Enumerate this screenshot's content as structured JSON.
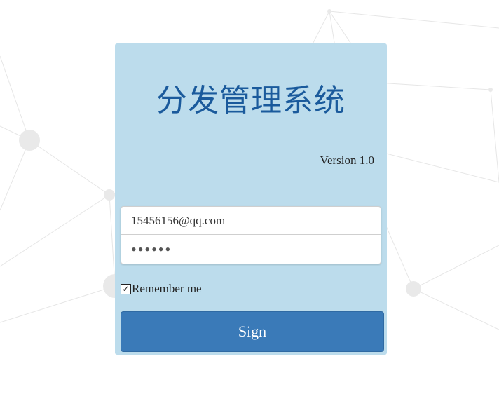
{
  "app": {
    "title": "分发管理系统",
    "version": "Version 1.0"
  },
  "form": {
    "email_value": "15456156@qq.com",
    "password_value": "••••••",
    "remember_label": "Remember me",
    "remember_checked": true,
    "submit_label": "Sign"
  },
  "colors": {
    "card_background": "#bcdcec",
    "title_color": "#1a5a9c",
    "button_background": "#3a7ab8"
  }
}
